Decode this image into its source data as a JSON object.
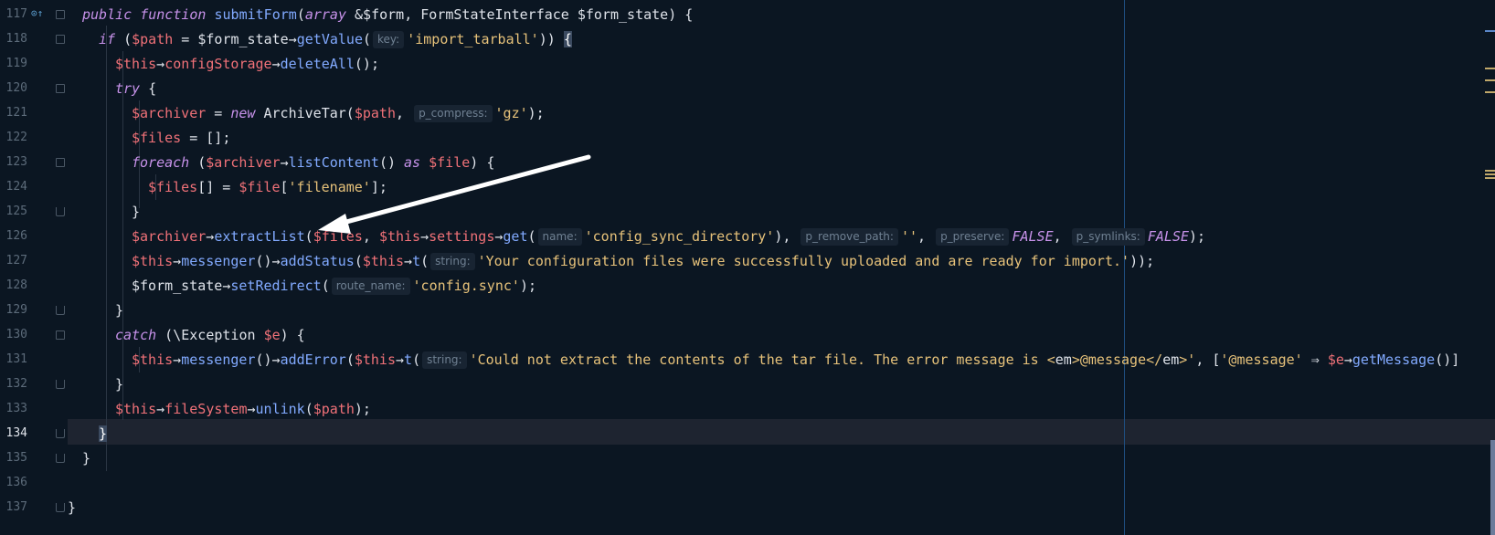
{
  "editor": {
    "current_line": 134,
    "line_numbers": [
      "117",
      "118",
      "119",
      "120",
      "121",
      "122",
      "123",
      "124",
      "125",
      "126",
      "127",
      "128",
      "129",
      "130",
      "131",
      "132",
      "133",
      "134",
      "135",
      "136",
      "137"
    ]
  },
  "lines": {
    "l117": {
      "kw1": "public",
      "kw2": "function",
      "fn": "submitForm",
      "p1": "(",
      "type": "array",
      "p2": " &$form, FormStateInterface $form_state) {"
    },
    "l118": {
      "kw": "if",
      "p1": " (",
      "var": "$path",
      "p2": " = $form_state",
      "arrow": "→",
      "fn": "getValue",
      "p3": "(",
      "hint": "key:",
      "str": "'import_tarball'",
      "p4": ")) ",
      "brace": "{"
    },
    "l119": {
      "var": "$this",
      "a1": "→",
      "m1": "configStorage",
      "a2": "→",
      "fn": "deleteAll",
      "p": "();"
    },
    "l120": {
      "kw": "try",
      "p": " {"
    },
    "l121": {
      "var": "$archiver",
      "p1": " = ",
      "kw": "new",
      "p2": " ArchiveTar(",
      "var2": "$path",
      "p3": ", ",
      "hint": "p_compress:",
      "str": "'gz'",
      "p4": ");"
    },
    "l122": {
      "var": "$files",
      "p": " = [];"
    },
    "l123": {
      "kw": "foreach",
      "p1": " (",
      "var": "$archiver",
      "a": "→",
      "fn": "listContent",
      "p2": "() ",
      "kw2": "as",
      "p3": " ",
      "var2": "$file",
      "p4": ") {"
    },
    "l124": {
      "var": "$files",
      "p1": "[] = ",
      "var2": "$file",
      "p2": "[",
      "str": "'filename'",
      "p3": "];"
    },
    "l125": {
      "p": "}"
    },
    "l126": {
      "var": "$archiver",
      "a1": "→",
      "fn": "extractList",
      "p1": "(",
      "var2": "$files",
      "p2": ", ",
      "var3": "$this",
      "a2": "→",
      "m": "settings",
      "a3": "→",
      "fn2": "get",
      "p3": "(",
      "h1": "name:",
      "s1": "'config_sync_directory'",
      "p4": "), ",
      "h2": "p_remove_path:",
      "s2": "''",
      "p5": ", ",
      "h3": "p_preserve:",
      "l1": "FALSE",
      "p6": ", ",
      "h4": "p_symlinks:",
      "l2": "FALSE",
      "p7": ");"
    },
    "l127": {
      "var": "$this",
      "a1": "→",
      "fn": "messenger",
      "p1": "()",
      "a2": "→",
      "fn2": "addStatus",
      "p2": "(",
      "var2": "$this",
      "a3": "→",
      "fn3": "t",
      "p3": "(",
      "hint": "string:",
      "str": "'Your configuration files were successfully uploaded and are ready for import.'",
      "p4": "));"
    },
    "l128": {
      "p1": "$form_state",
      "a": "→",
      "fn": "setRedirect",
      "p2": "(",
      "hint": "route_name:",
      "str": "'config.sync'",
      "p3": ");"
    },
    "l129": {
      "p": "}"
    },
    "l130": {
      "kw": "catch",
      "p1": " (\\Exception ",
      "var": "$e",
      "p2": ") {"
    },
    "l131": {
      "var": "$this",
      "a1": "→",
      "fn": "messenger",
      "p1": "()",
      "a2": "→",
      "fn2": "addError",
      "p2": "(",
      "var2": "$this",
      "a3": "→",
      "fn3": "t",
      "p3": "(",
      "hint": "string:",
      "s1": "'Could not extract the contents of the tar file. The error message is <",
      "s_em1": "em",
      "s2": ">@message</",
      "s_em2": "em",
      "s3": ">'",
      "p4": ", [",
      "s4": "'@message'",
      "p5": " ⇒ ",
      "var3": "$e",
      "a4": "→",
      "fn4": "getMessage",
      "p6": "()]"
    },
    "l132": {
      "p": "}"
    },
    "l133": {
      "var": "$this",
      "a1": "→",
      "fn": "fileSystem",
      "a2": "→",
      "fn2": "unlink",
      "p1": "(",
      "var2": "$path",
      "p2": ");"
    },
    "l134": {
      "brace": "}"
    },
    "l135": {
      "p": "}"
    },
    "l137": {
      "p": "}"
    }
  },
  "colors": {
    "background": "#0b1622",
    "keyword": "#c792ea",
    "function": "#82aaff",
    "variable": "#f07178",
    "string": "#e7c27a"
  },
  "icons": {
    "gutter": "override-method-icon"
  }
}
